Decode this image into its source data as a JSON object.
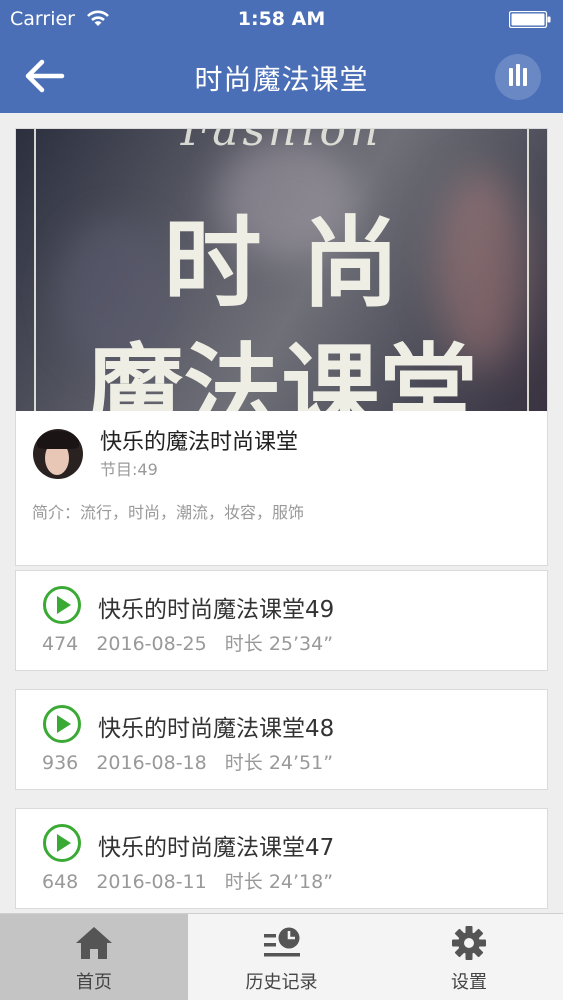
{
  "status_bar": {
    "carrier": "Carrier",
    "time": "1:58 AM",
    "icons": [
      "wifi-icon",
      "battery-icon"
    ]
  },
  "nav": {
    "title": "时尚魔法课堂",
    "back_icon": "arrow-left-icon",
    "playing_icon": "equalizer-icon"
  },
  "album": {
    "cover_text_top": "Fashion",
    "cover_text_line1": "时尚",
    "cover_text_line2": "魔法课堂",
    "title": "快乐的魔法时尚课堂",
    "count": "节目:49",
    "intro": "简介：流行，时尚，潮流，妆容，服饰"
  },
  "episodes": [
    {
      "title": "快乐的时尚魔法课堂49",
      "plays": "474",
      "date": "2016-08-25",
      "duration": "时长 25’34”"
    },
    {
      "title": "快乐的时尚魔法课堂48",
      "plays": "936",
      "date": "2016-08-18",
      "duration": "时长 24’51”"
    },
    {
      "title": "快乐的时尚魔法课堂47",
      "plays": "648",
      "date": "2016-08-11",
      "duration": "时长 24’18”"
    }
  ],
  "tabs": [
    {
      "label": "首页",
      "icon": "home-icon",
      "active": true
    },
    {
      "label": "历史记录",
      "icon": "history-icon",
      "active": false
    },
    {
      "label": "设置",
      "icon": "gear-icon",
      "active": false
    }
  ],
  "colors": {
    "nav_bar": "#4a6fb7",
    "play_icon": "#3aaa35",
    "active_tab": "#c4c4c4"
  }
}
